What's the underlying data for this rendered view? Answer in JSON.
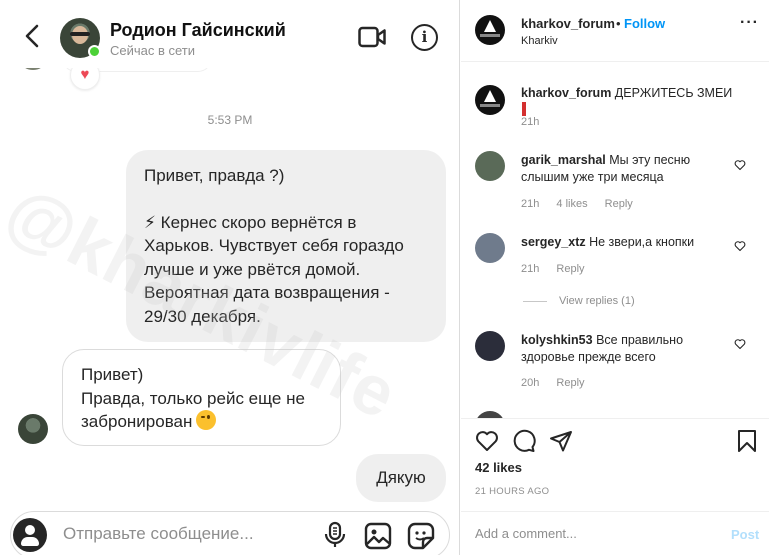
{
  "chat": {
    "contact_name": "Родион Гайсинский",
    "contact_status": "Сейчас в сети",
    "previous_reaction": "♥",
    "timestamp": "5:53 PM",
    "messages": [
      {
        "direction": "outgoing",
        "lines": [
          "Привет, правда ?)",
          "",
          "⚡ Кернес скоро вернётся в",
          "Харьков. Чувствует себя гораздо",
          "лучше и уже рвётся домой.",
          "Вероятная дата возвращения -",
          "29/30 декабря."
        ]
      },
      {
        "direction": "incoming",
        "lines": [
          "Привет)",
          "Правда, только рейс еще не",
          "забронирован"
        ]
      },
      {
        "direction": "outgoing",
        "lines": [
          "Дякую"
        ]
      }
    ],
    "watermark": "@kharkivlife",
    "composer_placeholder": "Отправьте сообщение...",
    "icons": {
      "back": "chevron-left-icon",
      "video": "video-call-icon",
      "info": "info-icon",
      "mic": "microphone-icon",
      "gallery": "image-icon",
      "sticker": "sticker-icon"
    },
    "colors": {
      "online": "#4cd137",
      "bubble_out": "#efefef",
      "heart": "#ed4956"
    }
  },
  "post": {
    "username": "kharkov_forum",
    "separator": "•",
    "follow_label": "Follow",
    "location": "Kharkiv",
    "more_label": "···",
    "caption": {
      "user": "kharkov_forum",
      "text": "ДЕРЖИТЕСЬ ЗМЕИ",
      "time": "21h"
    },
    "comments": [
      {
        "user": "garik_marshal",
        "text": "Мы эту песню слышим уже три месяца",
        "time": "21h",
        "likes": "4 likes",
        "reply": "Reply"
      },
      {
        "user": "sergey_xtz",
        "text": "Не звери,а кнопки",
        "time": "21h",
        "likes": "",
        "reply": "Reply"
      },
      {
        "user": "kolyshkin53",
        "text": "Все правильно здоровье прежде всего",
        "time": "20h",
        "likes": "",
        "reply": "Reply"
      }
    ],
    "view_replies": "View replies (1)",
    "likes_count": "42 likes",
    "posted_ago": "21 HOURS AGO",
    "add_comment_placeholder": "Add a comment...",
    "post_button": "Post",
    "colors": {
      "link": "#0095f6",
      "post_disabled": "#b2dffc",
      "mark": "#d32f2f"
    }
  }
}
